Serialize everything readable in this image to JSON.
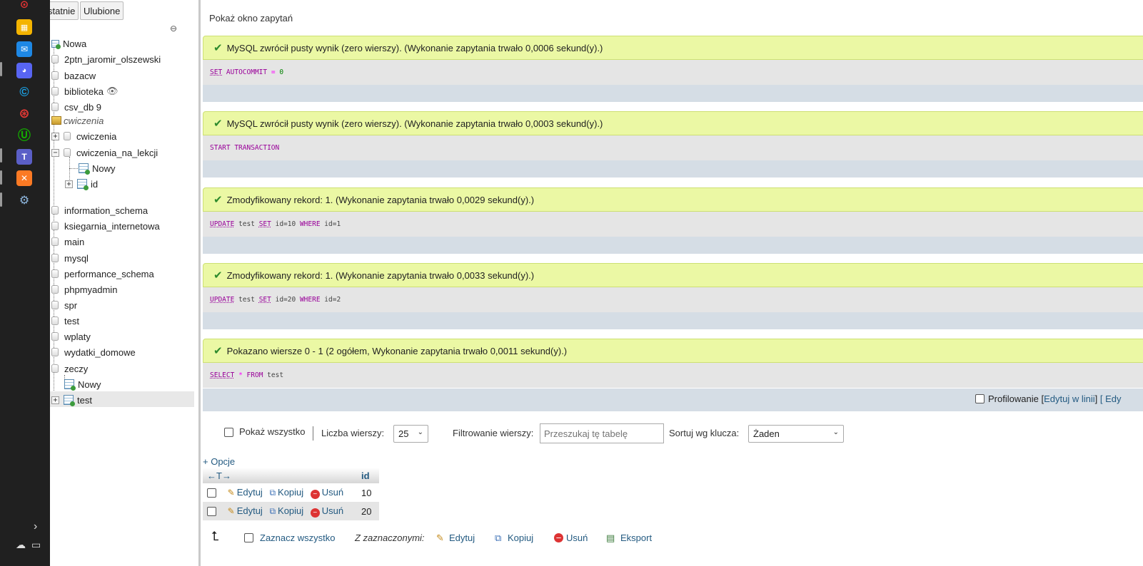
{
  "nav": {
    "tab_recent": "statnie",
    "tab_favorites": "Ulubione",
    "new_label": "Nowa",
    "databases": [
      "2ptn_jaromir_olszewski",
      "bazacw",
      "biblioteka",
      "csv_db 9"
    ],
    "group_label": "cwiczenia",
    "sub_db_1": "cwiczenia",
    "sub_db_2": "cwiczenia_na_lekcji",
    "sub_new": "Nowy",
    "sub_table": "id",
    "databases_2": [
      "information_schema",
      "ksiegarnia_internetowa",
      "main",
      "mysql",
      "performance_schema",
      "phpmyadmin",
      "spr",
      "test",
      "wplaty",
      "wydatki_domowe",
      "zeczy"
    ],
    "zeczy_new": "Nowy",
    "zeczy_table": "test"
  },
  "main": {
    "show_query_window": "Pokaż okno zapytań",
    "results": [
      {
        "message": "MySQL zwrócił pusty wynik (zero wierszy). (Wykonanie zapytania trwało 0,0006 sekund(y).)"
      },
      {
        "message": "MySQL zwrócił pusty wynik (zero wierszy). (Wykonanie zapytania trwało 0,0003 sekund(y).)"
      },
      {
        "message": "Zmodyfikowany rekord: 1. (Wykonanie zapytania trwało 0,0029 sekund(y).)"
      },
      {
        "message": "Zmodyfikowany rekord: 1. (Wykonanie zapytania trwało 0,0033 sekund(y).)"
      },
      {
        "message": "Pokazano wiersze 0 - 1 (2 ogółem, Wykonanie zapytania trwało 0,0011 sekund(y).)"
      }
    ],
    "sql": {
      "q1": {
        "set": "SET",
        "rest": "AUTOCOMMIT",
        "eq": "=",
        "val": "0"
      },
      "q2": {
        "text": "START TRANSACTION"
      },
      "q3": {
        "update": "UPDATE",
        "table": "test",
        "set": "SET",
        "assign": "id=10",
        "where": "WHERE",
        "cond": "id=1"
      },
      "q4": {
        "update": "UPDATE",
        "table": "test",
        "set": "SET",
        "assign": "id=20",
        "where": "WHERE",
        "cond": "id=2"
      },
      "q5": {
        "select": "SELECT",
        "star": "*",
        "from": "FROM",
        "table": "test"
      }
    },
    "profiling": "Profilowanie",
    "edit_inline": "Edytuj w linii",
    "edit_bracket_open": "[",
    "edit_bracket_close": "]",
    "edit_cut": "[ Edy",
    "show_all": "Pokaż wszystko",
    "rows_label": "Liczba wierszy:",
    "rows_value": "25",
    "filter_label": "Filtrowanie wierszy:",
    "filter_placeholder": "Przeszukaj tę tabelę",
    "sort_label": "Sortuj wg klucza:",
    "sort_value": "Żaden",
    "options": "+ Opcje",
    "column_header": "id",
    "column_arrows": "←T→",
    "rows": [
      {
        "edit": "Edytuj",
        "copy": "Kopiuj",
        "delete": "Usuń",
        "id": "10"
      },
      {
        "edit": "Edytuj",
        "copy": "Kopiuj",
        "delete": "Usuń",
        "id": "20"
      }
    ],
    "bottom": {
      "select_all": "Zaznacz wszystko",
      "with_selected": "Z zaznaczonymi:",
      "edit": "Edytuj",
      "copy": "Kopiuj",
      "delete": "Usuń",
      "export": "Eksport"
    }
  },
  "colors": {
    "success_bg": "#ebf8a4",
    "link": "#235a81",
    "keyword": "#990099",
    "taskbar": "#202020"
  }
}
